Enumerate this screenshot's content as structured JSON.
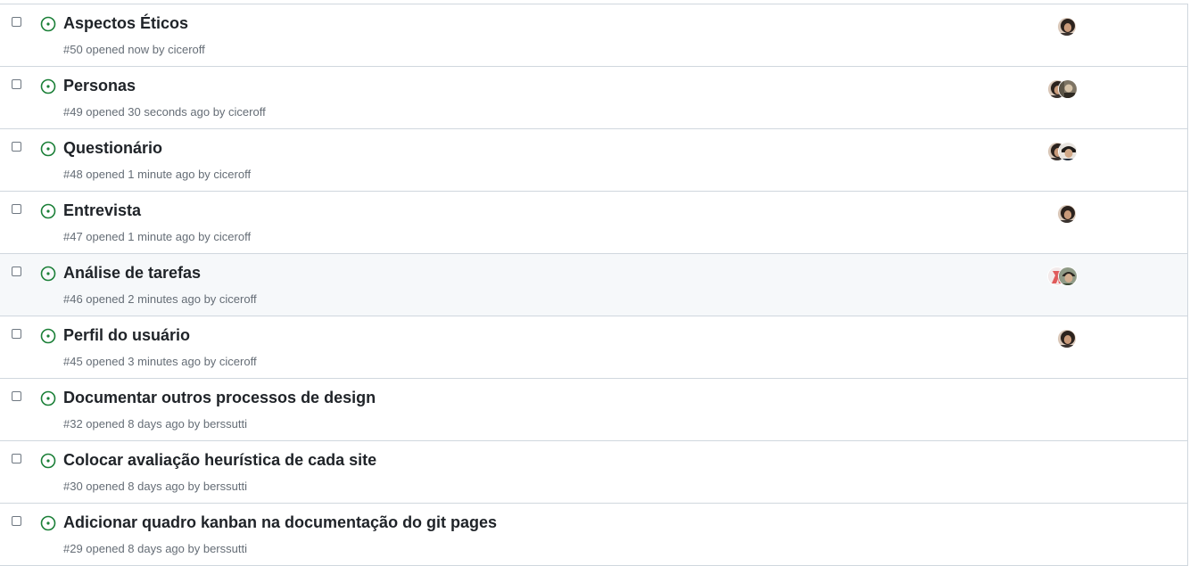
{
  "issues": [
    {
      "title": "Aspectos Éticos",
      "meta": "#50 opened now by ciceroff",
      "assignees": [
        "avatar-user-a"
      ]
    },
    {
      "title": "Personas",
      "meta": "#49 opened 30 seconds ago by ciceroff",
      "assignees": [
        "avatar-user-a",
        "avatar-user-b"
      ]
    },
    {
      "title": "Questionário",
      "meta": "#48 opened 1 minute ago by ciceroff",
      "assignees": [
        "avatar-user-a",
        "avatar-user-c"
      ]
    },
    {
      "title": "Entrevista",
      "meta": "#47 opened 1 minute ago by ciceroff",
      "assignees": [
        "avatar-user-a"
      ]
    },
    {
      "title": "Análise de tarefas",
      "meta": "#46 opened 2 minutes ago by ciceroff",
      "assignees": [
        "avatar-user-d",
        "avatar-user-e"
      ]
    },
    {
      "title": "Perfil do usuário",
      "meta": "#45 opened 3 minutes ago by ciceroff",
      "assignees": [
        "avatar-user-a"
      ]
    },
    {
      "title": "Documentar outros processos de design",
      "meta": "#32 opened 8 days ago by berssutti",
      "assignees": []
    },
    {
      "title": "Colocar avaliação heurística de cada site",
      "meta": "#30 opened 8 days ago by berssutti",
      "assignees": []
    },
    {
      "title": "Adicionar quadro kanban na documentação do git pages",
      "meta": "#29 opened 8 days ago by berssutti",
      "assignees": []
    }
  ],
  "icons": {
    "status": "issue-opened-icon"
  },
  "colors": {
    "open": "#1a7f37",
    "title": "#1f2328",
    "meta": "#656d76",
    "border": "#d0d7de",
    "hover": "#f6f8fa"
  }
}
